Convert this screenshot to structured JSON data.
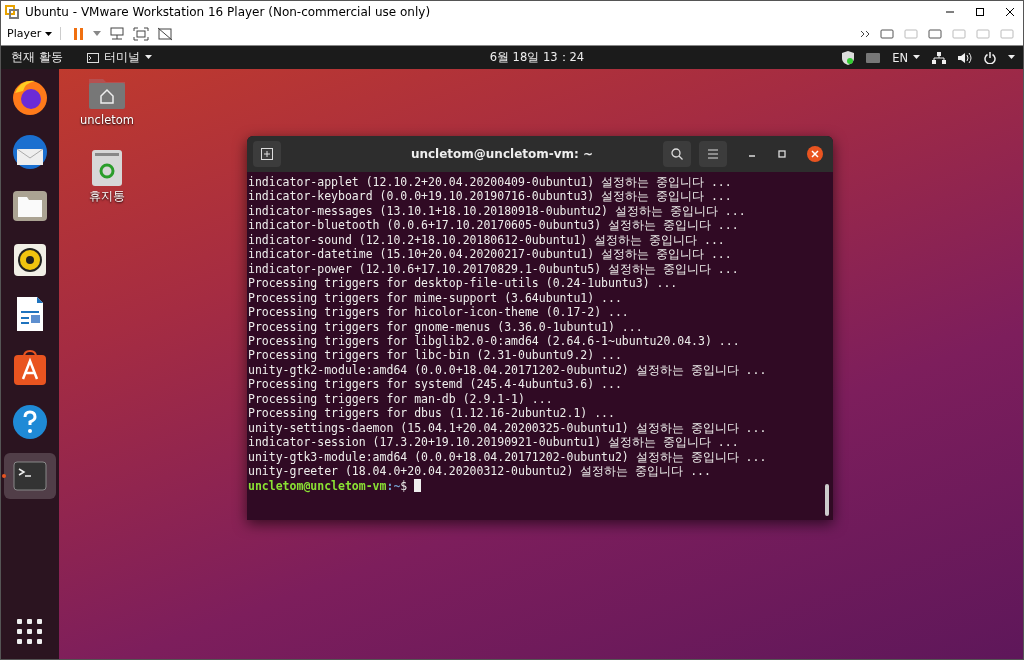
{
  "vmware": {
    "title": "Ubuntu - VMware Workstation 16 Player (Non-commercial use only)",
    "player_menu": "Player"
  },
  "topbar": {
    "activities": "현재 활동",
    "app_menu": "터미널",
    "clock": "6월 18일  13：24",
    "input_source": "EN"
  },
  "dock": [
    {
      "running": false
    },
    {
      "running": false
    },
    {
      "running": false
    },
    {
      "running": false
    },
    {
      "running": false
    },
    {
      "running": false
    },
    {
      "running": false
    },
    {
      "running": true
    }
  ],
  "desktop_icons": [
    {
      "label": "uncletom"
    },
    {
      "label": "휴지통"
    }
  ],
  "terminal": {
    "title": "uncletom@uncletom-vm: ~",
    "lines": [
      "indicator-applet (12.10.2+20.04.20200409-0ubuntu1) 설정하는 중입니다 ...",
      "indicator-keyboard (0.0.0+19.10.20190716-0ubuntu3) 설정하는 중입니다 ...",
      "indicator-messages (13.10.1+18.10.20180918-0ubuntu2) 설정하는 중입니다 ...",
      "indicator-bluetooth (0.0.6+17.10.20170605-0ubuntu3) 설정하는 중입니다 ...",
      "indicator-sound (12.10.2+18.10.20180612-0ubuntu1) 설정하는 중입니다 ...",
      "indicator-datetime (15.10+20.04.20200217-0ubuntu1) 설정하는 중입니다 ...",
      "indicator-power (12.10.6+17.10.20170829.1-0ubuntu5) 설정하는 중입니다 ...",
      "Processing triggers for desktop-file-utils (0.24-1ubuntu3) ...",
      "Processing triggers for mime-support (3.64ubuntu1) ...",
      "Processing triggers for hicolor-icon-theme (0.17-2) ...",
      "Processing triggers for gnome-menus (3.36.0-1ubuntu1) ...",
      "Processing triggers for libglib2.0-0:amd64 (2.64.6-1~ubuntu20.04.3) ...",
      "Processing triggers for libc-bin (2.31-0ubuntu9.2) ...",
      "unity-gtk2-module:amd64 (0.0.0+18.04.20171202-0ubuntu2) 설정하는 중입니다 ...",
      "Processing triggers for systemd (245.4-4ubuntu3.6) ...",
      "Processing triggers for man-db (2.9.1-1) ...",
      "Processing triggers for dbus (1.12.16-2ubuntu2.1) ...",
      "unity-settings-daemon (15.04.1+20.04.20200325-0ubuntu1) 설정하는 중입니다 ...",
      "indicator-session (17.3.20+19.10.20190921-0ubuntu1) 설정하는 중입니다 ...",
      "unity-gtk3-module:amd64 (0.0.0+18.04.20171202-0ubuntu2) 설정하는 중입니다 ...",
      "unity-greeter (18.04.0+20.04.20200312-0ubuntu2) 설정하는 중입니다 ..."
    ],
    "prompt": {
      "user_host": "uncletom@uncletom-vm",
      "path": ":~",
      "symbol": "$"
    }
  }
}
